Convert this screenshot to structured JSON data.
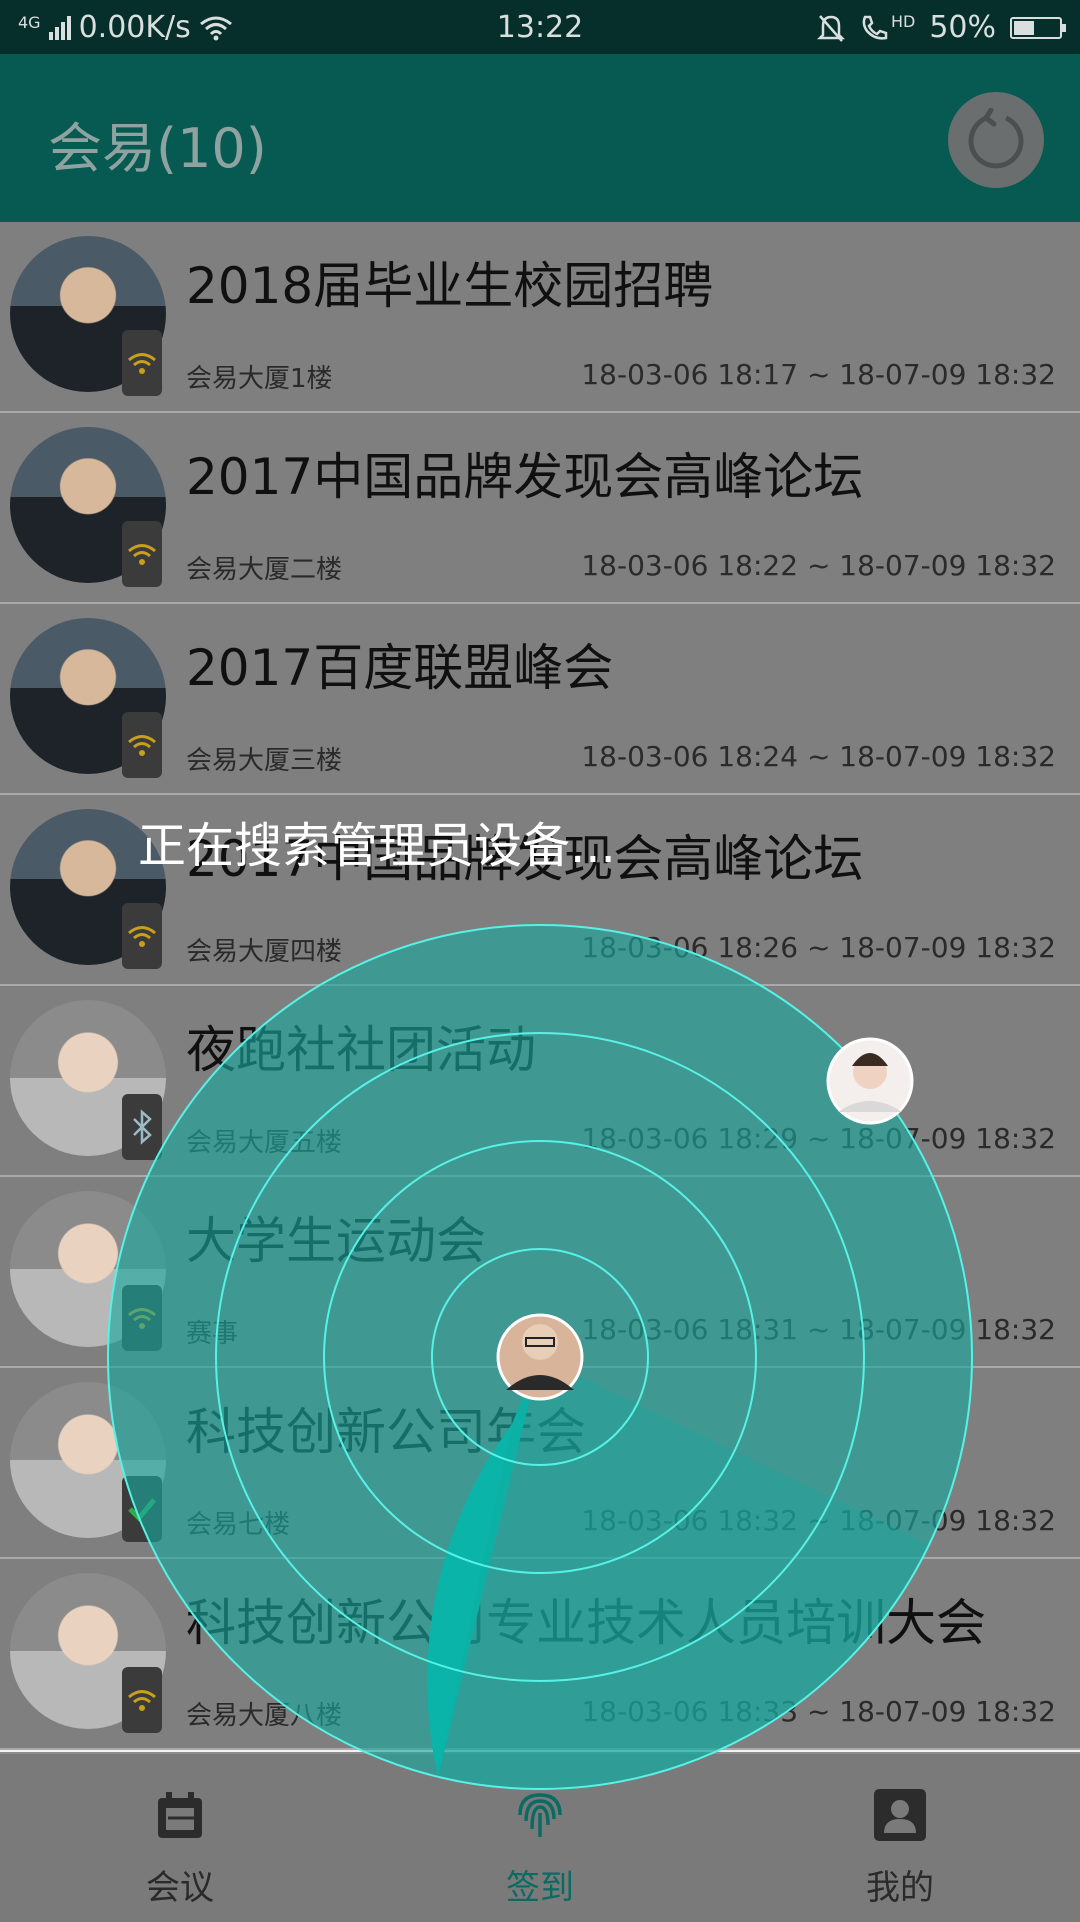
{
  "status_bar": {
    "network": "4G",
    "speed": "0.00K/s",
    "time": "13:22",
    "hd": "HD",
    "battery": "50%",
    "battery_level": 0.5
  },
  "app_bar": {
    "title": "会易(10)"
  },
  "meetings": [
    {
      "title": "2018届毕业生校园招聘",
      "location": "会易大厦1楼",
      "time": "18-03-06 18:17 ~ 18-07-09 18:32",
      "badge": "wifi"
    },
    {
      "title": "2017中国品牌发现会高峰论坛",
      "location": "会易大厦二楼",
      "time": "18-03-06 18:22 ~ 18-07-09 18:32",
      "badge": "wifi"
    },
    {
      "title": "2017百度联盟峰会",
      "location": "会易大厦三楼",
      "time": "18-03-06 18:24 ~ 18-07-09 18:32",
      "badge": "wifi"
    },
    {
      "title": "2017中国品牌发现会高峰论坛",
      "location": "会易大厦四楼",
      "time": "18-03-06 18:26 ~ 18-07-09 18:32",
      "badge": "wifi"
    },
    {
      "title": "夜跑社社团活动",
      "location": "会易大厦五楼",
      "time": "18-03-06 18:29 ~ 18-07-09 18:32",
      "badge": "bluetooth"
    },
    {
      "title": "大学生运动会",
      "location": "赛事",
      "time": "18-03-06 18:31 ~ 18-07-09 18:32",
      "badge": "wifi"
    },
    {
      "title": "科技创新公司年会",
      "location": "会易七楼",
      "time": "18-03-06 18:32 ~ 18-07-09 18:32",
      "badge": "check"
    },
    {
      "title": "科技创新公司专业技术人员培训大会",
      "location": "会易大厦八楼",
      "time": "18-03-06 18:33 ~ 18-07-09 18:32",
      "badge": "wifi"
    }
  ],
  "overlay": {
    "message": "正在搜索管理员设备..."
  },
  "bottom_nav": {
    "items": [
      {
        "label": "会议",
        "icon": "calendar-icon"
      },
      {
        "label": "签到",
        "icon": "fingerprint-icon"
      },
      {
        "label": "我的",
        "icon": "profile-icon"
      }
    ],
    "active_index": 1
  },
  "colors": {
    "primary": "#075a52",
    "radar": "#16b8ae",
    "radar_line": "#4ff3e6",
    "active_nav": "#0a6b63"
  }
}
